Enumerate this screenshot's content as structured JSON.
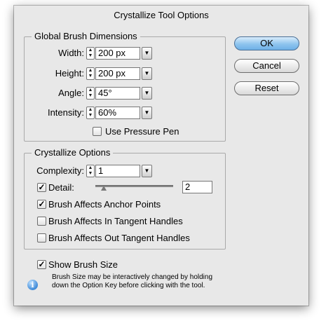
{
  "dialog": {
    "title": "Crystallize Tool Options",
    "buttons": {
      "ok": "OK",
      "cancel": "Cancel",
      "reset": "Reset"
    }
  },
  "global_brush": {
    "legend": "Global Brush Dimensions",
    "width": {
      "label": "Width:",
      "value": "200 px"
    },
    "height": {
      "label": "Height:",
      "value": "200 px"
    },
    "angle": {
      "label": "Angle:",
      "value": "45°"
    },
    "intensity": {
      "label": "Intensity:",
      "value": "60%"
    },
    "use_pressure_pen": {
      "label": "Use Pressure Pen",
      "checked": false
    }
  },
  "crystallize": {
    "legend": "Crystallize Options",
    "complexity": {
      "label": "Complexity:",
      "value": "1"
    },
    "detail": {
      "label": "Detail:",
      "checked": true,
      "value": "2"
    },
    "anchor_points": {
      "label": "Brush Affects Anchor Points",
      "checked": true
    },
    "in_tangent": {
      "label": "Brush Affects In Tangent Handles",
      "checked": false
    },
    "out_tangent": {
      "label": "Brush Affects Out Tangent Handles",
      "checked": false
    }
  },
  "show_brush_size": {
    "label": "Show Brush Size",
    "checked": true
  },
  "note": "Brush Size may be interactively changed by holding down the Option Key before clicking with the tool.",
  "icons": {
    "stepper": "stepper-icon",
    "dropdown": "chevron-down-icon",
    "info": "info-icon"
  }
}
